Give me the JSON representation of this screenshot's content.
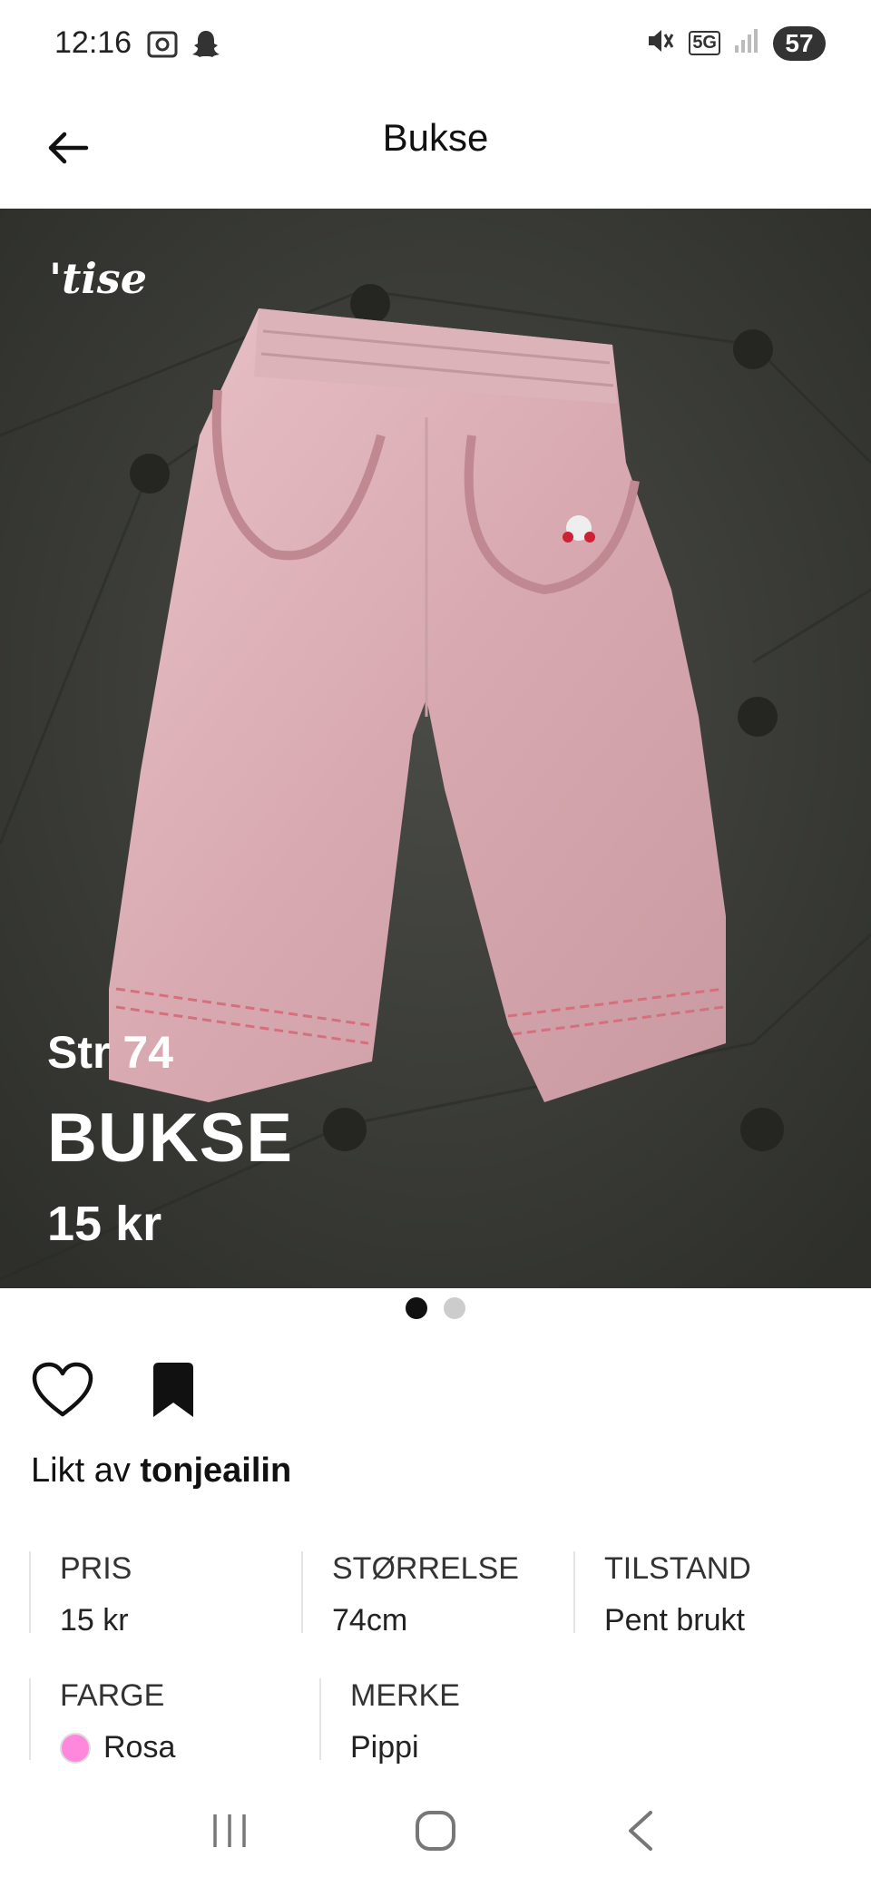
{
  "status_bar": {
    "time": "12:16",
    "network": "5G",
    "battery": "57",
    "icons_left": [
      "screenshot-icon",
      "snapchat-icon"
    ],
    "icons_right": [
      "mute-icon",
      "5g-icon",
      "signal-icon",
      "battery-icon"
    ]
  },
  "app_bar": {
    "title": "Bukse",
    "back_icon": "arrow-left-icon"
  },
  "hero": {
    "watermark": "'tise",
    "size_text": "Str 74",
    "title_text": "BUKSE",
    "price_text": "15 kr",
    "image_count": 2,
    "active_index": 0
  },
  "actions": {
    "like_icon": "heart-icon",
    "save_icon": "bookmark-icon"
  },
  "liked_by": {
    "prefix": "Likt av",
    "user": "tonjeailin"
  },
  "details": {
    "price_label": "PRIS",
    "price_value": "15 kr",
    "size_label": "STØRRELSE",
    "size_value": "74cm",
    "condition_label": "TILSTAND",
    "condition_value": "Pent brukt",
    "color_label": "FARGE",
    "color_value": "Rosa",
    "color_hex": "#ff88dd",
    "brand_label": "MERKE",
    "brand_value": "Pippi"
  },
  "nav": {
    "recents_icon": "recents-icon",
    "home_icon": "home-icon",
    "back_icon": "back-chevron-icon"
  }
}
